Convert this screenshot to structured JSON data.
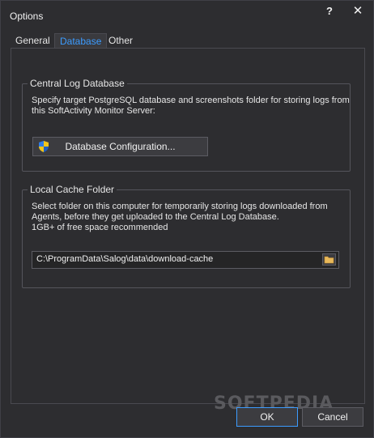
{
  "window": {
    "title": "Options",
    "help_label": "?",
    "close_label": "✕"
  },
  "tabs": [
    {
      "label": "General",
      "selected": false
    },
    {
      "label": "Database",
      "selected": true
    },
    {
      "label": "Other",
      "selected": false
    }
  ],
  "central_log": {
    "legend": "Central Log Database",
    "description": "Specify target PostgreSQL database and screenshots folder for storing logs from\nthis SoftActivity Monitor Server:",
    "button_label": "Database Configuration..."
  },
  "local_cache": {
    "legend": "Local Cache Folder",
    "description": "Select folder on this computer for temporarily storing logs downloaded from\nAgents, before they get uploaded to the Central Log Database.\n1GB+ of free space recommended",
    "path_value": "C:\\ProgramData\\Salog\\data\\download-cache"
  },
  "watermark": "SOFTPEDIA",
  "buttons": {
    "ok_label": "OK",
    "cancel_label": "Cancel"
  },
  "colors": {
    "accent": "#3c9cff",
    "background": "#2d2d30",
    "text": "#e6e6e6"
  },
  "icons": {
    "config": "uac-shield-icon",
    "browse": "folder-icon"
  }
}
